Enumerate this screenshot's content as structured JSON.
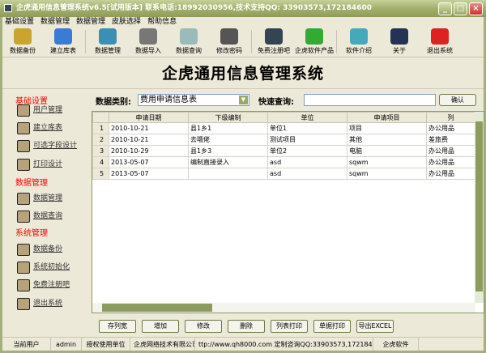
{
  "window": {
    "title": "企虎通用信息管理系统v6.5[试用版本]  联系电话:18992030956,技术支持QQ:  33903573,172184600"
  },
  "menu": [
    "基础设置",
    "数据管理",
    "数据管理",
    "皮肤选择",
    "帮助信息"
  ],
  "toolbar": [
    {
      "label": "数据备份",
      "icon": "database-backup-icon",
      "color": "#c9a530"
    },
    {
      "label": "建立库表",
      "icon": "create-table-icon",
      "color": "#3a7bd5"
    },
    {
      "label": "数据管理",
      "icon": "folder-icon",
      "color": "#3b8fb5"
    },
    {
      "label": "数据导入",
      "icon": "database-import-icon",
      "color": "#777"
    },
    {
      "label": "数据查询",
      "icon": "magnifier-icon",
      "color": "#9bb"
    },
    {
      "label": "修改密码",
      "icon": "key-icon",
      "color": "#555"
    },
    {
      "label": "免费注册吧",
      "icon": "register-icon",
      "color": "#345"
    },
    {
      "label": "企虎软件产品",
      "icon": "refresh-icon",
      "color": "#3a3"
    },
    {
      "label": "软件介绍",
      "icon": "chat-icon",
      "color": "#4ab"
    },
    {
      "label": "关于",
      "icon": "about-icon",
      "color": "#235"
    },
    {
      "label": "退出系统",
      "icon": "exit-icon",
      "color": "#d22"
    }
  ],
  "banner": "企虎通用信息管理系统",
  "sidebar": {
    "sections": [
      {
        "title": "基础设置",
        "items": [
          "用户管理",
          "建立库表",
          "可选字段设计",
          "打印设计"
        ]
      },
      {
        "title": "数据管理",
        "items": [
          "数据管理",
          "数据查询"
        ]
      },
      {
        "title": "系统管理",
        "items": [
          "数据备份",
          "系统初始化",
          "免费注册吧",
          "退出系统"
        ]
      }
    ]
  },
  "filter": {
    "category_label": "数据类别:",
    "category_value": "费用申请信息表",
    "query_label": "快速查询:",
    "query_value": "",
    "confirm": "确认"
  },
  "table": {
    "columns": [
      "申请日期",
      "下级编制",
      "单位",
      "申请项目",
      "列"
    ],
    "rows": [
      [
        "1",
        "2010-10-21",
        "县1乡1",
        "单位1",
        "项目",
        "办公用品"
      ],
      [
        "2",
        "2010-10-21",
        "去哦佬",
        "测试项目",
        "其他",
        "差旅费"
      ],
      [
        "3",
        "2010-10-29",
        "县1乡3",
        "单位2",
        "电脑",
        "办公用品"
      ],
      [
        "4",
        "2013-05-07",
        "编制直接录入",
        "asd",
        "sqwm",
        "办公用品"
      ],
      [
        "5",
        "2013-05-07",
        "",
        "asd",
        "sqwm",
        "办公用品"
      ]
    ]
  },
  "buttons": [
    "存列宽",
    "增加",
    "修改",
    "删除",
    "列表打印",
    "单据打印",
    "导出EXCEL"
  ],
  "status": [
    "当前用户",
    "admin",
    "授权使用单位",
    "企虎网络技术有限公司",
    "ttp://www.qh8000.com 定制咨询QQ:33903573,172184600 电话:18",
    "企虎软件"
  ]
}
